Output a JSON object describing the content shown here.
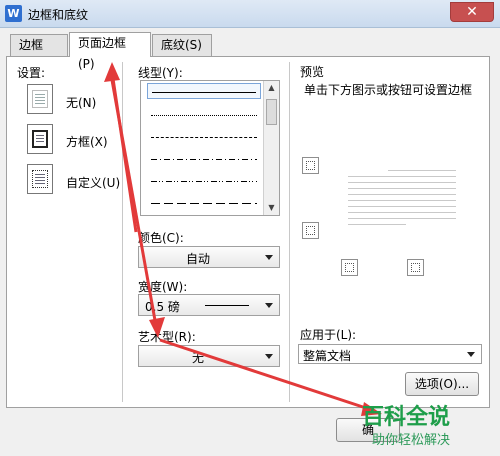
{
  "window": {
    "title": "边框和底纹",
    "close_glyph": "✕",
    "app_icon_letter": "W"
  },
  "tabs": [
    {
      "label": "边框(B)",
      "active": false
    },
    {
      "label": "页面边框(P)",
      "active": true
    },
    {
      "label": "底纹(S)",
      "active": false
    }
  ],
  "settings": {
    "heading": "设置:",
    "options": [
      {
        "label": "无(N)",
        "icon": "page-none-icon"
      },
      {
        "label": "方框(X)",
        "icon": "page-box-icon"
      },
      {
        "label": "自定义(U)",
        "icon": "page-custom-icon"
      }
    ]
  },
  "line_style": {
    "label": "线型(Y):",
    "selected_index": 0,
    "styles": [
      "solid",
      "dotted",
      "dashed",
      "dash-dot",
      "dash-dot-dot",
      "long-dash"
    ]
  },
  "color": {
    "label": "颜色(C):",
    "value": "自动"
  },
  "width": {
    "label": "宽度(W):",
    "value": "0.5 磅"
  },
  "art": {
    "label": "艺术型(R):",
    "value": "无"
  },
  "preview": {
    "heading": "预览",
    "hint": "单击下方图示或按钮可设置边框"
  },
  "apply_to": {
    "label": "应用于(L):",
    "value": "整篇文档"
  },
  "buttons": {
    "options": "选项(O)...",
    "ok": "确"
  },
  "watermark": {
    "logo": "百科全说",
    "subtitle": "助你轻松解决"
  },
  "colors": {
    "annotation_arrow": "#e23a3a",
    "titlebar": "#c9daee",
    "close_button": "#c75050",
    "watermark_green": "#1e9e4a"
  }
}
